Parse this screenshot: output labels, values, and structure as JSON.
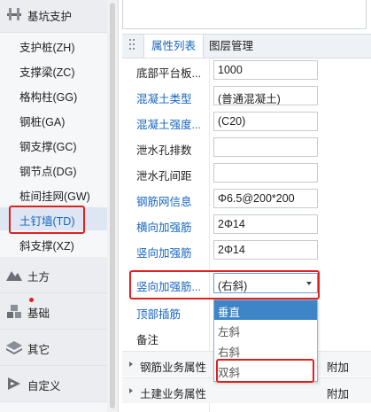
{
  "sidebar": {
    "top_category": "基坑支护",
    "items": [
      {
        "label": "支护桩(ZH)"
      },
      {
        "label": "支撑梁(ZC)"
      },
      {
        "label": "格构柱(GG)"
      },
      {
        "label": "钢桩(GA)"
      },
      {
        "label": "钢支撑(GC)"
      },
      {
        "label": "钢节点(DG)"
      },
      {
        "label": "桩间挂网(GW)"
      },
      {
        "label": "土钉墙(TD)"
      },
      {
        "label": "斜支撑(XZ)"
      }
    ],
    "categories": [
      {
        "label": "土方",
        "icon": "earthwork-icon"
      },
      {
        "label": "基础",
        "icon": "foundation-icon"
      },
      {
        "label": "其它",
        "icon": "layers-icon"
      },
      {
        "label": "自定义",
        "icon": "custom-icon"
      }
    ],
    "selected_item": "土钉墙(TD)"
  },
  "tabs": {
    "active": "属性列表",
    "other": "图层管理"
  },
  "properties": [
    {
      "name": "底部平台板...",
      "value": "1000",
      "link": false
    },
    {
      "name": "混凝土类型",
      "value": "(普通混凝土)",
      "link": true
    },
    {
      "name": "混凝土强度...",
      "value": "(C20)",
      "link": true
    },
    {
      "name": "泄水孔排数",
      "value": "",
      "link": false
    },
    {
      "name": "泄水孔间距",
      "value": "",
      "link": false
    },
    {
      "name": "钢筋网信息",
      "value": "Φ6.5@200*200",
      "link": true
    },
    {
      "name": "横向加强筋",
      "value": "2Φ14",
      "link": true
    },
    {
      "name": "竖向加强筋",
      "value": "2Φ14",
      "link": true
    },
    {
      "name": "竖向加强筋...",
      "value": "(右斜)",
      "link": true
    },
    {
      "name": "顶部插筋",
      "value": "",
      "link": true
    },
    {
      "name": "备注",
      "value": "",
      "link": false
    }
  ],
  "dropdown_options": [
    "垂直",
    "左斜",
    "右斜",
    "双斜"
  ],
  "dropdown_highlighted": "垂直",
  "groups": [
    {
      "name": "钢筋业务属性",
      "extra": "附加"
    },
    {
      "name": "土建业务属性",
      "extra": "附加"
    }
  ],
  "colors": {
    "accent": "#1565c0",
    "highlight_box": "#e0201c",
    "selection": "#3d85c6"
  }
}
